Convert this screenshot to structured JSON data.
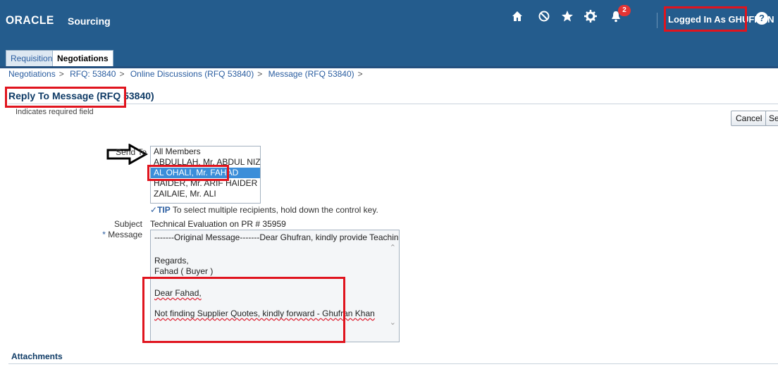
{
  "header": {
    "logo": "ORACLE",
    "product": "Sourcing",
    "notification_count": "2",
    "logged_in": "Logged In As GHUFRAN",
    "help": "?"
  },
  "tabs": [
    {
      "label": "Requisitions"
    },
    {
      "label": "Negotiations"
    }
  ],
  "breadcrumbs": [
    "Negotiations",
    "RFQ: 53840",
    "Online Discussions (RFQ 53840)",
    "Message (RFQ 53840)"
  ],
  "breadcrumb_separator": ">",
  "page": {
    "title": "Reply To Message (RFQ 53840)",
    "required_note": "Indicates required field"
  },
  "buttons": {
    "cancel": "Cancel",
    "send": "Se"
  },
  "form": {
    "send_to_label": "Send To",
    "recipients": [
      "All Members",
      "ABDULLAH, Mr. ABDUL NIZAM",
      "AL OHALI, Mr. FAHAD",
      "HAIDER, Mr. ARIF HAIDER",
      "ZAILAIE, Mr. ALI"
    ],
    "selected_recipient": "AL OHALI, Mr. FAHAD",
    "tip_label": "TIP",
    "tip_text": "To select multiple recipients, hold down the control key.",
    "subject_label": "Subject",
    "subject_value": "Technical Evaluation on PR # 35959",
    "message_label": "Message",
    "message_lines": {
      "original": "-------Original Message-------Dear Ghufran, kindly provide Teachinival Evaluation",
      "regards": "Regards,",
      "signature": "Fahad ( Buyer )",
      "reply_greeting": "Dear Fahad,",
      "reply_body": "Not finding Supplier Quotes, kindly forward - Ghufran Khan"
    }
  },
  "attachments_label": "Attachments",
  "colors": {
    "header_bg": "#245c8d",
    "highlight_red": "#e0141e",
    "selected_row": "#3b8ed9",
    "title_text": "#0f3b66"
  }
}
